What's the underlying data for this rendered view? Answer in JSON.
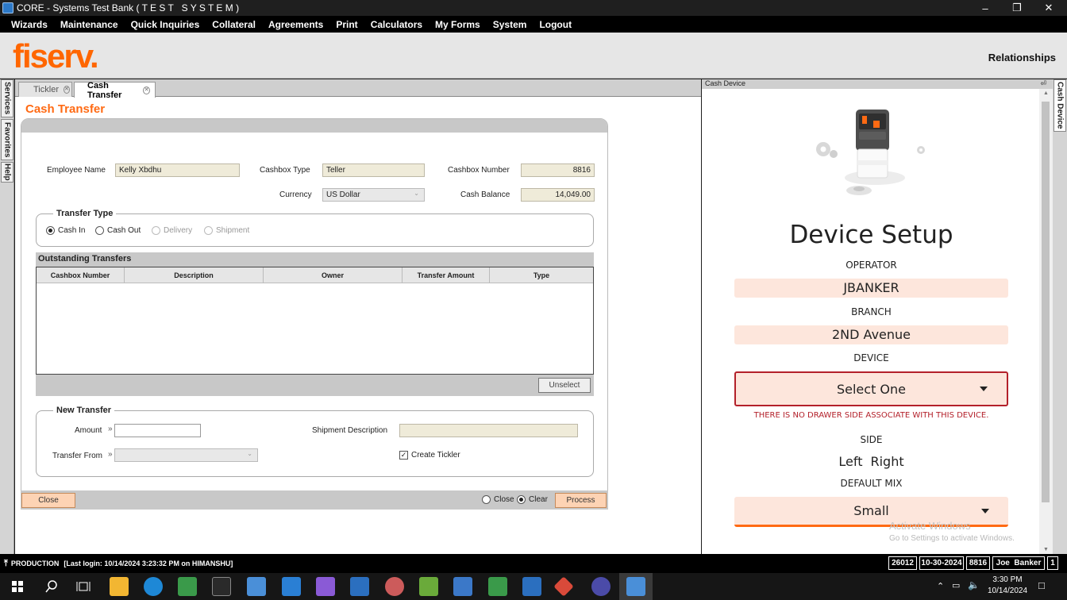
{
  "window": {
    "title": "CORE - Systems Test Bank ( T E S T   S Y S T E M )"
  },
  "menu": [
    "Wizards",
    "Maintenance",
    "Quick Inquiries",
    "Collateral",
    "Agreements",
    "Print",
    "Calculators",
    "My Forms",
    "System",
    "Logout"
  ],
  "header": {
    "logo": "fiserv.",
    "relationships": "Relationships"
  },
  "left_tabs": [
    "Services",
    "Favorites",
    "Help"
  ],
  "tabs": [
    {
      "label": "Tickler"
    },
    {
      "label": "Cash Transfer"
    }
  ],
  "form": {
    "title": "Cash Transfer",
    "employee_name_label": "Employee Name",
    "employee_name": "Kelly Xbdhu",
    "cashbox_type_label": "Cashbox Type",
    "cashbox_type": "Teller",
    "cashbox_number_label": "Cashbox Number",
    "cashbox_number": "8816",
    "currency_label": "Currency",
    "currency": "US Dollar",
    "cash_balance_label": "Cash Balance",
    "cash_balance": "14,049.00",
    "transfer_type": {
      "legend": "Transfer Type",
      "options": [
        "Cash In",
        "Cash Out",
        "Delivery",
        "Shipment"
      ],
      "selected": "Cash In"
    },
    "outstanding": {
      "title": "Outstanding Transfers",
      "columns": [
        "Cashbox Number",
        "Description",
        "Owner",
        "Transfer Amount",
        "Type"
      ],
      "rows": [],
      "unselect_label": "Unselect"
    },
    "new_transfer": {
      "legend": "New Transfer",
      "amount_label": "Amount",
      "amount": "",
      "shipment_description_label": "Shipment Description",
      "transfer_from_label": "Transfer From",
      "create_tickler_label": "Create Tickler",
      "create_tickler": true,
      "marker": "»"
    },
    "close_label": "Close",
    "after_process": {
      "close": "Close",
      "clear": "Clear",
      "selected": "Clear"
    },
    "process_label": "Process"
  },
  "cash_device": {
    "panel_title": "Cash Device",
    "side_tab": "Cash Device",
    "title": "Device Setup",
    "operator_label": "OPERATOR",
    "operator": "JBANKER",
    "branch_label": "BRANCH",
    "branch": "2ND Avenue",
    "device_label": "DEVICE",
    "device_select": "Select One",
    "error": "THERE IS NO DRAWER SIDE ASSOCIATE WITH THIS DEVICE.",
    "side_label": "SIDE",
    "side_left": "Left",
    "side_right": "Right",
    "default_mix_label": "DEFAULT MIX",
    "default_mix": "Small",
    "watermark_1": "Activate Windows",
    "watermark_2": "Go to Settings to activate Windows.",
    "accent_color": "#ff6a13",
    "error_color": "#b3202a"
  },
  "status": {
    "environment": "PRODUCTION",
    "last_login": "[Last login: 10/14/2024 3:23:32 PM on HIMANSHU]",
    "boxes": [
      "26012",
      "10-30-2024",
      "8816",
      "Joe  Banker",
      "1"
    ]
  },
  "taskbar": {
    "time": "3:30 PM",
    "date": "10/14/2024"
  }
}
